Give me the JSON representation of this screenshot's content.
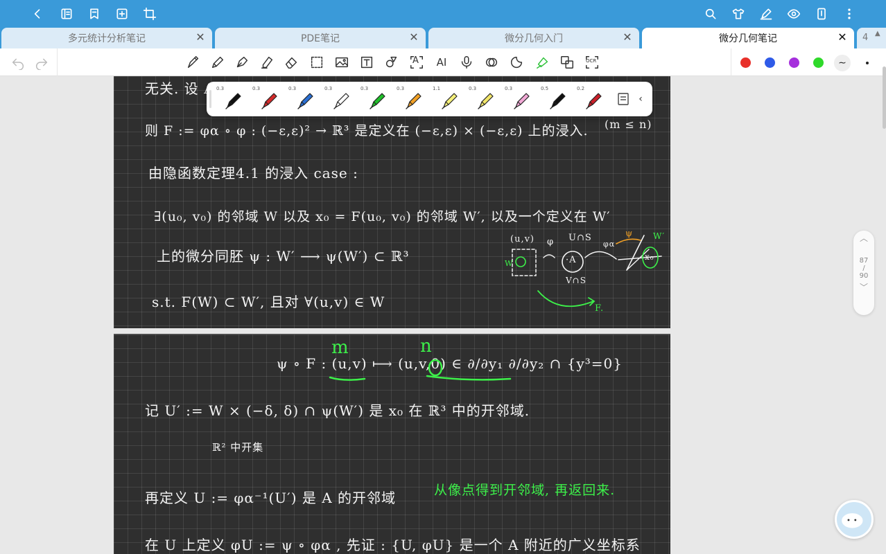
{
  "tabs": [
    {
      "label": "多元统计分析笔记",
      "active": false
    },
    {
      "label": "PDE笔记",
      "active": false
    },
    {
      "label": "微分几何入门",
      "active": false
    },
    {
      "label": "微分几何笔记",
      "active": true
    }
  ],
  "tab_overflow_count": "4",
  "colors": {
    "topbar": "#3a9ad9",
    "swatch_red": "#e8302a",
    "swatch_blue": "#2f5be8",
    "swatch_purple": "#a52fdc",
    "swatch_green": "#2fd92a",
    "ink_green": "#3df04a"
  },
  "toolbar": {
    "text_tool_label": "T",
    "ai_tool_label": "AI",
    "ocr_tool_label": "OCR",
    "shape_tool_label": "A"
  },
  "pens": [
    {
      "width": "0.3",
      "color": "#111111"
    },
    {
      "width": "0.3",
      "color": "#d32b2b"
    },
    {
      "width": "0.3",
      "color": "#2a6fd3"
    },
    {
      "width": "0.3",
      "color": "#ffffff"
    },
    {
      "width": "0.3",
      "color": "#1fbf2a"
    },
    {
      "width": "0.3",
      "color": "#f2a126"
    },
    {
      "width": "1.1",
      "color": "#f5f07a"
    },
    {
      "width": "0.3",
      "color": "#f2e66a"
    },
    {
      "width": "0.3",
      "color": "#f2a9d6"
    },
    {
      "width": "0.5",
      "color": "#111111"
    },
    {
      "width": "0.2",
      "color": "#c9202a"
    }
  ],
  "page_indicator": {
    "current": "87",
    "sep": "/",
    "total": "90"
  },
  "notes_page1": [
    "无关.  设 A",
    "则 F := φα ∘ φ : (−ε,ε)² → ℝ³ 是定义在 (−ε,ε) × (−ε,ε) 上的浸入.",
    "(m ≤ n)",
    "由隐函数定理4.1 的浸入 case :",
    "∃(u₀, v₀) 的邻域 W 以及 x₀ = F(u₀, v₀) 的邻域 W′,  以及一个定义在 W′",
    "上的微分同胚      ψ : W′ ⟶ ψ(W′) ⊂ ℝ³",
    "s.t.    F(W) ⊂ W′,   且对 ∀(u,v) ∈ W"
  ],
  "diagram": {
    "uv": "(u,v)",
    "phi": "φ",
    "w": "W",
    "a": "·A",
    "u_cap_s_top": "U∩S",
    "u_cap_s_bottom": "V∩S",
    "phi_alpha": "φα",
    "psi": "ψ",
    "x0": "x₀",
    "w_prime": "W′",
    "f": "F."
  },
  "notes_page2": [
    "ψ ∘ F :  (u,v)  ⟼ (u,v,0) ∈ ∂/∂y₁ ∂/∂y₂ ∩ {y³=0}",
    "记 U′ := W × (−δ, δ) ∩ ψ(W′)  是  x₀ 在 ℝ³ 中的开邻域.",
    "ℝ² 中开集",
    "再定义 U := φα⁻¹(U′)  是 A 的开邻域",
    "在 U 上定义  φU := ψ ∘ φα ,  先证 : {U, φU} 是一个 A 附近的广义坐标系"
  ],
  "green_annotations": {
    "m": "m",
    "n": "n",
    "remark": "从像点得到开邻域, 再返回来."
  }
}
